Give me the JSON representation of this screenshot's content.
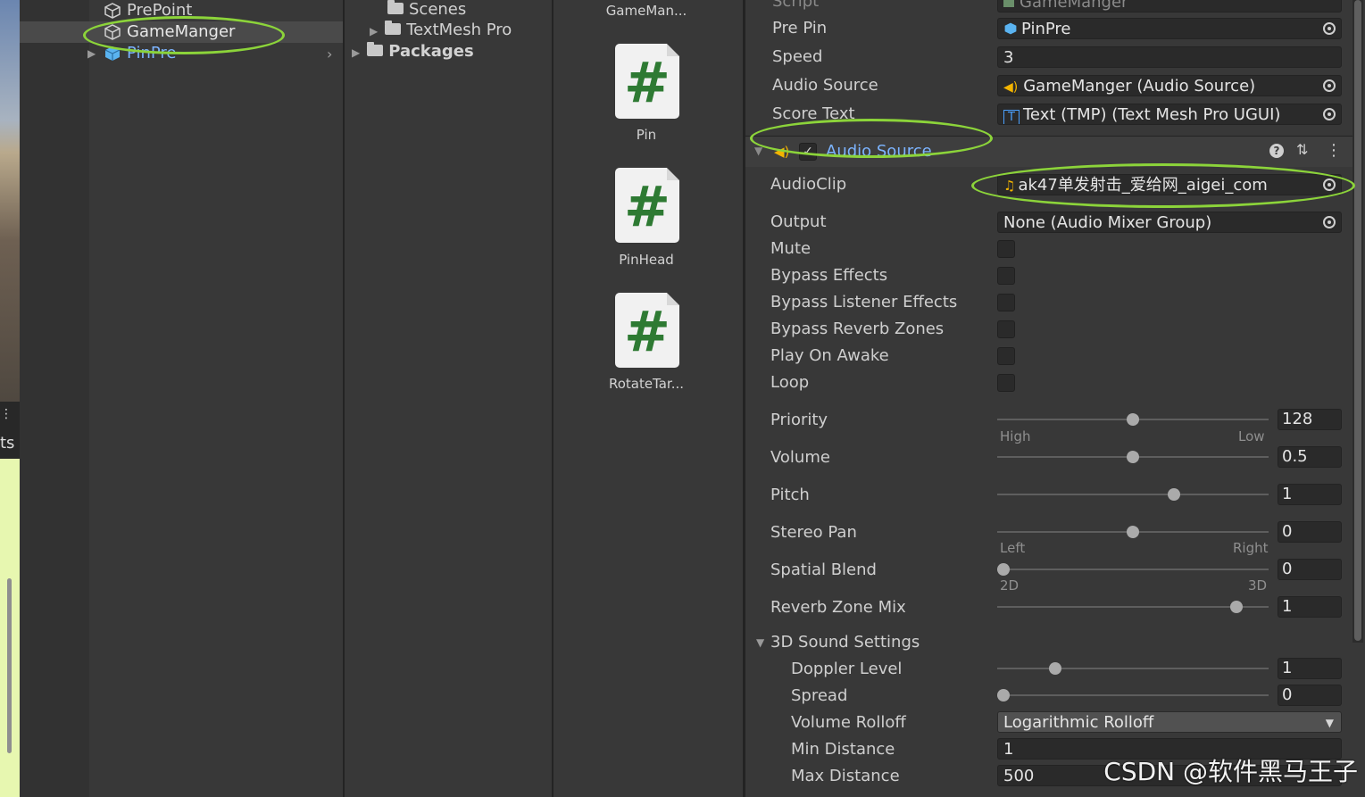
{
  "scene": {
    "label": "ts"
  },
  "hierarchy": {
    "items": [
      {
        "label": "PrePoint"
      },
      {
        "label": "GameManger"
      },
      {
        "label": "PinPre"
      }
    ]
  },
  "project_tree": {
    "items": [
      {
        "label": "Scenes"
      },
      {
        "label": "TextMesh Pro"
      },
      {
        "label": "Packages"
      }
    ]
  },
  "project_grid": {
    "top_label": "GameMan...",
    "items": [
      {
        "label": "Pin",
        "glyph": "#"
      },
      {
        "label": "PinHead",
        "glyph": "#"
      },
      {
        "label": "RotateTar...",
        "glyph": "#"
      }
    ]
  },
  "inspector": {
    "script": {
      "label": "Script",
      "value": "GameManger"
    },
    "fields": [
      {
        "label": "Pre Pin",
        "value": "PinPre",
        "icon": "prefab-cube-icon"
      },
      {
        "label": "Speed",
        "value": "3"
      },
      {
        "label": "Audio Source",
        "value": "GameManger (Audio Source)",
        "icon": "audio-source-icon"
      },
      {
        "label": "Score Text",
        "value": "Text (TMP) (Text Mesh Pro UGUI)",
        "icon": "tmp-text-icon"
      }
    ],
    "component": {
      "title": "Audio Source",
      "help": "?",
      "more": "⋮"
    },
    "audio_clip": {
      "label": "AudioClip",
      "value": "ak47单发射击_爱给网_aigei_com"
    },
    "output": {
      "label": "Output",
      "value": "None (Audio Mixer Group)"
    },
    "toggles": [
      {
        "label": "Mute",
        "checked": false
      },
      {
        "label": "Bypass Effects",
        "checked": false
      },
      {
        "label": "Bypass Listener Effects",
        "checked": false
      },
      {
        "label": "Bypass Reverb Zones",
        "checked": false
      },
      {
        "label": "Play On Awake",
        "checked": false
      },
      {
        "label": "Loop",
        "checked": false
      }
    ],
    "sliders": [
      {
        "label": "Priority",
        "value": "128",
        "min_label": "High",
        "max_label": "Low",
        "fraction": 0.5
      },
      {
        "label": "Volume",
        "value": "0.5",
        "fraction": 0.5
      },
      {
        "label": "Pitch",
        "value": "1",
        "fraction": 0.66
      },
      {
        "label": "Stereo Pan",
        "value": "0",
        "min_label": "Left",
        "max_label": "Right",
        "fraction": 0.5
      },
      {
        "label": "Spatial Blend",
        "value": "0",
        "min_label": "2D",
        "max_label": "3D",
        "fraction": 0.0
      },
      {
        "label": "Reverb Zone Mix",
        "value": "1",
        "fraction": 0.9
      }
    ],
    "sound3d": {
      "title": "3D Sound Settings",
      "sliders": [
        {
          "label": "Doppler Level",
          "value": "1",
          "fraction": 0.2
        },
        {
          "label": "Spread",
          "value": "0",
          "fraction": 0.0
        }
      ],
      "volume_rolloff": {
        "label": "Volume Rolloff",
        "value": "Logarithmic Rolloff"
      },
      "min_distance": {
        "label": "Min Distance",
        "value": "1"
      },
      "max_distance": {
        "label": "Max Distance",
        "value": "500"
      }
    }
  },
  "watermark": "CSDN @软件黑马王子",
  "colors": {
    "highlight": "#8cd43a",
    "link_blue": "#7cb4ff"
  }
}
